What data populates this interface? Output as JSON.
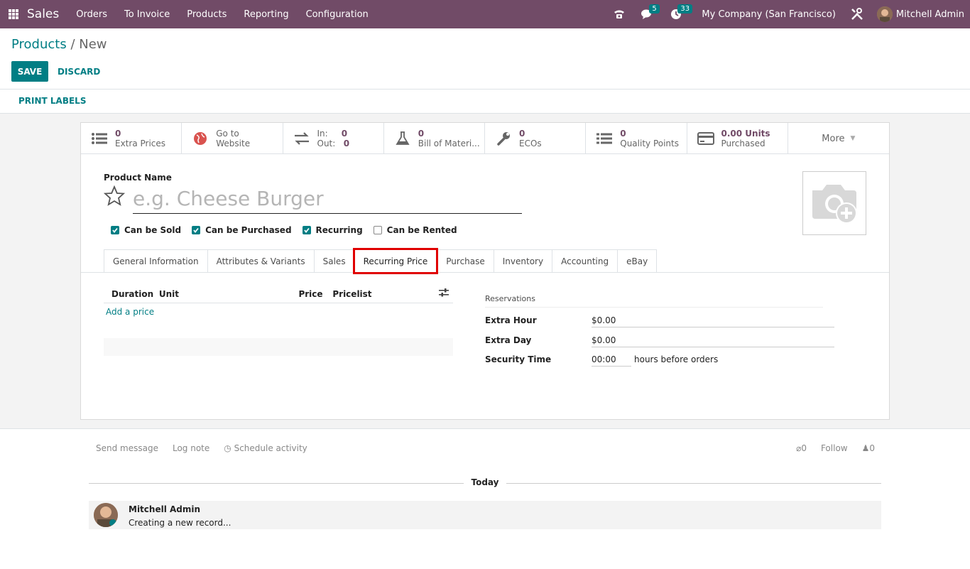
{
  "navbar": {
    "app_name": "Sales",
    "menu": [
      "Orders",
      "To Invoice",
      "Products",
      "Reporting",
      "Configuration"
    ],
    "messages_count": "5",
    "activities_count": "33",
    "company": "My Company (San Francisco)",
    "user": "Mitchell Admin",
    "color": "#714B67"
  },
  "breadcrumb": {
    "parent": "Products",
    "sep": " / ",
    "current": "New"
  },
  "buttons": {
    "save": "SAVE",
    "discard": "DISCARD",
    "print_labels": "PRINT LABELS"
  },
  "smart_buttons": [
    {
      "num": "0",
      "label": "Extra Prices",
      "icon": "list-icon"
    },
    {
      "num": "Go to",
      "label": "Website",
      "icon": "globe-icon"
    },
    {
      "in_label": "In:",
      "in_val": "0",
      "out_label": "Out:",
      "out_val": "0",
      "icon": "exchange-icon"
    },
    {
      "num": "0",
      "label": "Bill of Materi...",
      "icon": "flask-icon"
    },
    {
      "num": "0",
      "label": "ECOs",
      "icon": "wrench-icon"
    },
    {
      "num": "0",
      "label": "Quality Points",
      "icon": "list-icon"
    },
    {
      "num": "0.00 Units",
      "label": "Purchased",
      "icon": "credit-card-icon"
    },
    {
      "label": "More"
    }
  ],
  "product": {
    "name_label": "Product Name",
    "name_placeholder": "e.g. Cheese Burger",
    "checkboxes": [
      {
        "label": "Can be Sold",
        "checked": true
      },
      {
        "label": "Can be Purchased",
        "checked": true
      },
      {
        "label": "Recurring",
        "checked": true
      },
      {
        "label": "Can be Rented",
        "checked": false
      }
    ]
  },
  "tabs": [
    "General Information",
    "Attributes & Variants",
    "Sales",
    "Recurring Price",
    "Purchase",
    "Inventory",
    "Accounting",
    "eBay"
  ],
  "active_tab": "Recurring Price",
  "price_table": {
    "headers": [
      "Duration",
      "Unit",
      "Price",
      "Pricelist"
    ],
    "add_label": "Add a price"
  },
  "reservations": {
    "title": "Reservations",
    "extra_hour_label": "Extra Hour",
    "extra_hour_value": "$0.00",
    "extra_day_label": "Extra Day",
    "extra_day_value": "$0.00",
    "security_label": "Security Time",
    "security_value": "00:00",
    "security_suffix": "hours before orders"
  },
  "chatter": {
    "send_message": "Send message",
    "log_note": "Log note",
    "schedule_activity": "Schedule activity",
    "attachments": "0",
    "follow": "Follow",
    "followers": "0",
    "today": "Today",
    "author": "Mitchell Admin",
    "message": "Creating a new record..."
  }
}
